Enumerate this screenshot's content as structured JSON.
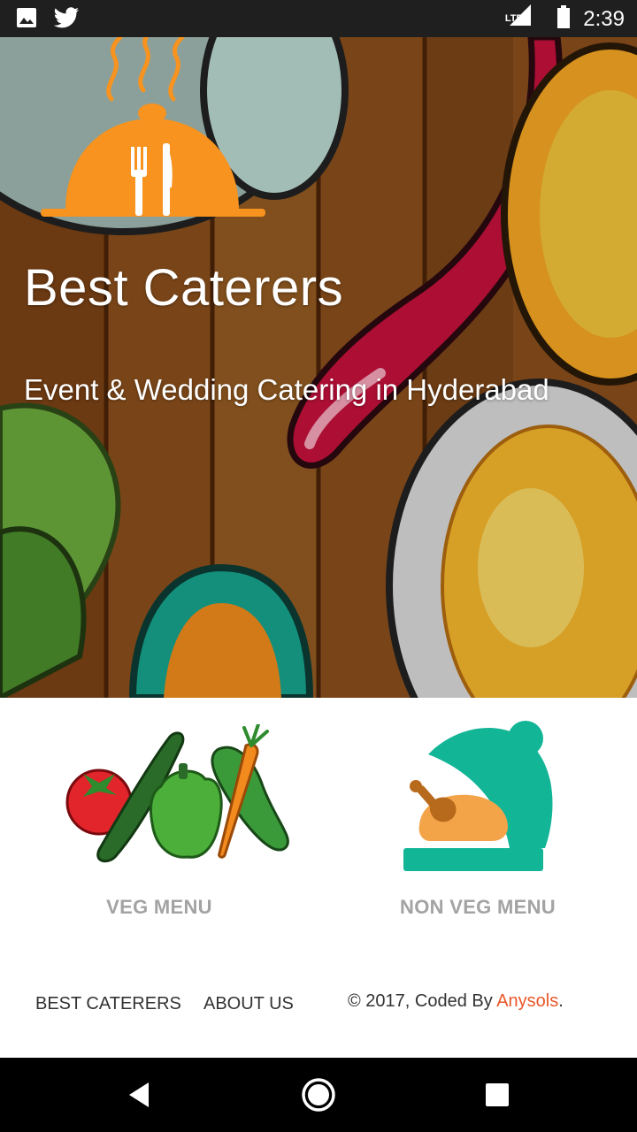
{
  "status_bar": {
    "time": "2:39",
    "network": "LTE",
    "icons": [
      "image-icon",
      "twitter-icon",
      "signal-icon",
      "battery-icon"
    ]
  },
  "hero": {
    "title": "Best Caterers",
    "subtitle": "Event & Wedding Catering in Hyderabad",
    "logo_color": "#f7931e"
  },
  "menus": [
    {
      "label": "VEG MENU",
      "icon": "vegetables-icon"
    },
    {
      "label": "NON VEG MENU",
      "icon": "chicken-cloche-icon",
      "color": "#13b597"
    }
  ],
  "footer": {
    "links": [
      "BEST CATERERS",
      "ABOUT US"
    ],
    "copyright_prefix": "© 2017, Coded By ",
    "copyright_brand": "Anysols",
    "copyright_suffix": ".",
    "brand_color": "#e8572a"
  },
  "nav_bar": {
    "buttons": [
      "back-icon",
      "home-icon",
      "recents-icon"
    ]
  }
}
